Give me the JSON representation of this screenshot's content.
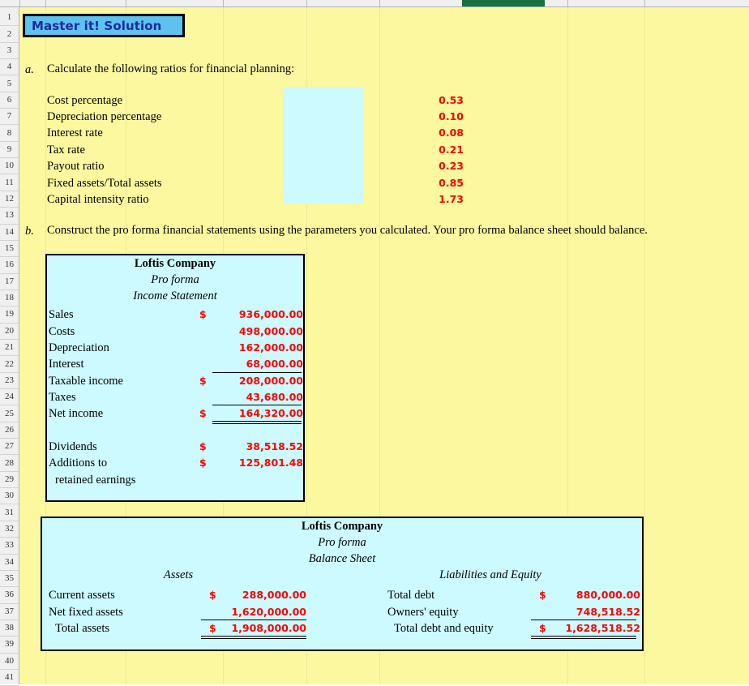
{
  "spreadsheet": {
    "row_numbers": [
      1,
      2,
      3,
      4,
      5,
      6,
      7,
      8,
      9,
      10,
      11,
      12,
      13,
      14,
      15,
      16,
      17,
      18,
      19,
      20,
      21,
      22,
      23,
      24,
      25,
      26,
      27,
      28,
      29,
      30,
      31,
      32,
      33,
      34,
      35,
      36,
      37,
      38,
      39,
      40,
      41
    ],
    "sheet_background": "#FBF8A0",
    "selected_column_highlight_color": "#1A7040",
    "accent_value_color": "#FF0000",
    "panel_fill_color": "#CCFAFF"
  },
  "banner": {
    "title": "Master it! Solution",
    "fill": "#5EC2F0",
    "text_color": "#1F2A9C"
  },
  "part_a": {
    "marker": "a.",
    "instruction": "Calculate the following ratios for financial planning:",
    "ratios": [
      {
        "label": "Cost percentage",
        "value": "0.53"
      },
      {
        "label": "Depreciation percentage",
        "value": "0.10"
      },
      {
        "label": "Interest rate",
        "value": "0.08"
      },
      {
        "label": "Tax rate",
        "value": "0.21"
      },
      {
        "label": "Payout ratio",
        "value": "0.23"
      },
      {
        "label": "Fixed assets/Total assets",
        "value": "0.85"
      },
      {
        "label": "Capital intensity ratio",
        "value": "1.73"
      }
    ]
  },
  "part_b": {
    "marker": "b.",
    "instruction": "Construct the pro forma financial statements using the parameters you calculated. Your pro forma balance sheet should balance."
  },
  "income_statement": {
    "company": "Loftis Company",
    "subtitle1": "Pro forma",
    "subtitle2": "Income Statement",
    "rows": [
      {
        "label": "Sales",
        "symbol": "$",
        "value": "936,000.00"
      },
      {
        "label": "Costs",
        "symbol": "",
        "value": "498,000.00"
      },
      {
        "label": "Depreciation",
        "symbol": "",
        "value": "162,000.00"
      },
      {
        "label": "Interest",
        "symbol": "",
        "value": "68,000.00"
      },
      {
        "label": "Taxable income",
        "symbol": "$",
        "value": "208,000.00"
      },
      {
        "label": "Taxes",
        "symbol": "",
        "value": "43,680.00"
      },
      {
        "label": "Net income",
        "symbol": "$",
        "value": "164,320.00"
      }
    ],
    "distribution": [
      {
        "label": "Dividends",
        "symbol": "$",
        "value": "38,518.52"
      },
      {
        "label": "Additions to",
        "symbol": "$",
        "value": "125,801.48"
      }
    ],
    "distribution_cont": "retained earnings"
  },
  "balance_sheet": {
    "company": "Loftis Company",
    "subtitle1": "Pro forma",
    "subtitle2": "Balance Sheet",
    "assets_heading": "Assets",
    "liabilities_heading": "Liabilities and Equity",
    "assets": [
      {
        "label": "Current assets",
        "symbol": "$",
        "value": "288,000.00"
      },
      {
        "label": "Net fixed assets",
        "symbol": "",
        "value": "1,620,000.00"
      },
      {
        "label": "Total assets",
        "symbol": "$",
        "value": "1,908,000.00"
      }
    ],
    "liabilities": [
      {
        "label": "Total debt",
        "symbol": "$",
        "value": "880,000.00"
      },
      {
        "label": "Owners' equity",
        "symbol": "",
        "value": "748,518.52"
      },
      {
        "label": "Total debt and equity",
        "symbol": "$",
        "value": "1,628,518.52"
      }
    ]
  }
}
